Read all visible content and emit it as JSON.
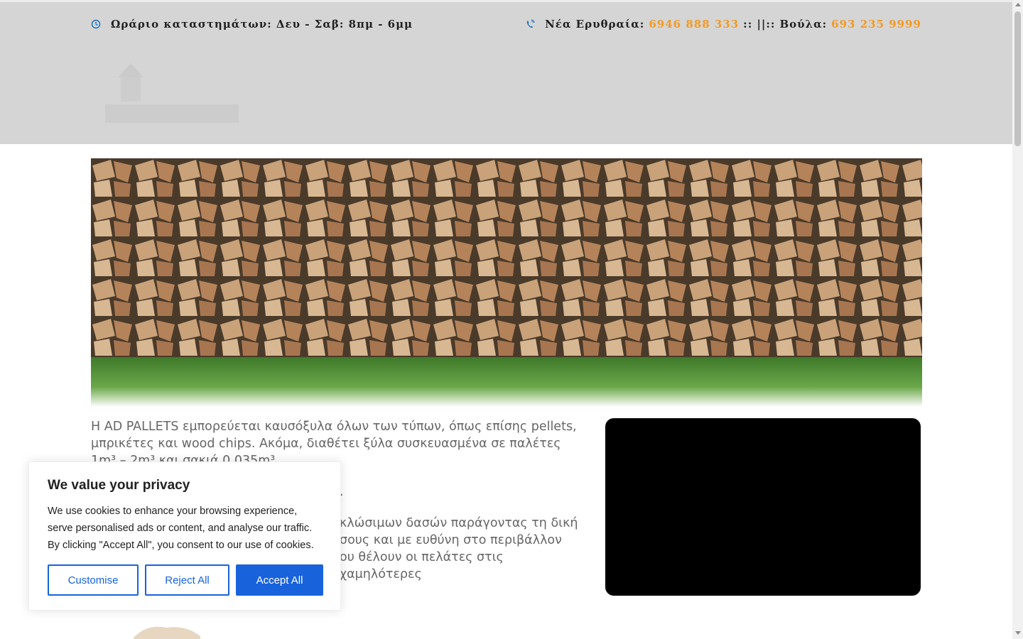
{
  "topbar": {
    "hours": "Ωράριο καταστημάτων: Δευ - Σαβ: 8πμ - 6μμ",
    "contact_nea_label": "Νέα Ερυθραία:",
    "contact_nea_phone": "6946 888 333",
    "contact_sep": ":: ||::",
    "contact_voula_label": "Βούλα:",
    "contact_voula_phone": "693 235 9999",
    "hours_icon": "clock-icon",
    "phone_icon": "phone-icon"
  },
  "main": {
    "hero_image": "firewood-stack",
    "intro_paragraph_1": "Η AD PALLETS εμπορεύεται καυσόξυλα όλων των τύπων, όπως επίσης pellets, μπρικέτες και wood chips. Ακόμα, διαθέτει ξύλα συσκευασμένα σε παλέτες 1m³ – 2m³ και σακιά 0,035m³.",
    "intro_paragraph_2": ".",
    "intro_paragraph_3_visible": "κλώσιμων δασών παράγοντας τη δική",
    "intro_paragraph_3_line2": "σους και με ευθύνη στο περιβάλλον",
    "intro_paragraph_3_line3": "ου θέλουν οι πελάτες στις χαμηλότερες"
  },
  "cookie": {
    "title": "We value your privacy",
    "body": "We use cookies to enhance your browsing experience, serve personalised ads or content, and analyse our traffic. By clicking \"Accept All\", you consent to our use of cookies.",
    "customise_label": "Customise",
    "reject_label": "Reject All",
    "accept_label": "Accept All"
  },
  "colors": {
    "accent": "#f29a23",
    "icon_blue": "#1e73be",
    "cookie_blue": "#1863dc",
    "header_bg": "#d5d5d5"
  }
}
